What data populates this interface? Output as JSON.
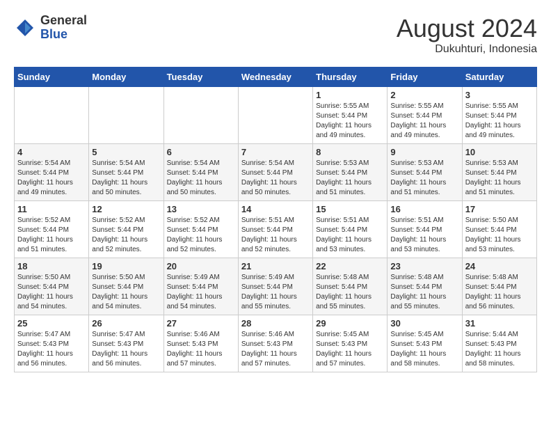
{
  "logo": {
    "general": "General",
    "blue": "Blue"
  },
  "title": {
    "month": "August 2024",
    "location": "Dukuhturi, Indonesia"
  },
  "days_of_week": [
    "Sunday",
    "Monday",
    "Tuesday",
    "Wednesday",
    "Thursday",
    "Friday",
    "Saturday"
  ],
  "weeks": [
    [
      {
        "day": "",
        "sunrise": "",
        "sunset": "",
        "daylight": ""
      },
      {
        "day": "",
        "sunrise": "",
        "sunset": "",
        "daylight": ""
      },
      {
        "day": "",
        "sunrise": "",
        "sunset": "",
        "daylight": ""
      },
      {
        "day": "",
        "sunrise": "",
        "sunset": "",
        "daylight": ""
      },
      {
        "day": "1",
        "sunrise": "Sunrise: 5:55 AM",
        "sunset": "Sunset: 5:44 PM",
        "daylight": "Daylight: 11 hours and 49 minutes."
      },
      {
        "day": "2",
        "sunrise": "Sunrise: 5:55 AM",
        "sunset": "Sunset: 5:44 PM",
        "daylight": "Daylight: 11 hours and 49 minutes."
      },
      {
        "day": "3",
        "sunrise": "Sunrise: 5:55 AM",
        "sunset": "Sunset: 5:44 PM",
        "daylight": "Daylight: 11 hours and 49 minutes."
      }
    ],
    [
      {
        "day": "4",
        "sunrise": "Sunrise: 5:54 AM",
        "sunset": "Sunset: 5:44 PM",
        "daylight": "Daylight: 11 hours and 49 minutes."
      },
      {
        "day": "5",
        "sunrise": "Sunrise: 5:54 AM",
        "sunset": "Sunset: 5:44 PM",
        "daylight": "Daylight: 11 hours and 50 minutes."
      },
      {
        "day": "6",
        "sunrise": "Sunrise: 5:54 AM",
        "sunset": "Sunset: 5:44 PM",
        "daylight": "Daylight: 11 hours and 50 minutes."
      },
      {
        "day": "7",
        "sunrise": "Sunrise: 5:54 AM",
        "sunset": "Sunset: 5:44 PM",
        "daylight": "Daylight: 11 hours and 50 minutes."
      },
      {
        "day": "8",
        "sunrise": "Sunrise: 5:53 AM",
        "sunset": "Sunset: 5:44 PM",
        "daylight": "Daylight: 11 hours and 51 minutes."
      },
      {
        "day": "9",
        "sunrise": "Sunrise: 5:53 AM",
        "sunset": "Sunset: 5:44 PM",
        "daylight": "Daylight: 11 hours and 51 minutes."
      },
      {
        "day": "10",
        "sunrise": "Sunrise: 5:53 AM",
        "sunset": "Sunset: 5:44 PM",
        "daylight": "Daylight: 11 hours and 51 minutes."
      }
    ],
    [
      {
        "day": "11",
        "sunrise": "Sunrise: 5:52 AM",
        "sunset": "Sunset: 5:44 PM",
        "daylight": "Daylight: 11 hours and 51 minutes."
      },
      {
        "day": "12",
        "sunrise": "Sunrise: 5:52 AM",
        "sunset": "Sunset: 5:44 PM",
        "daylight": "Daylight: 11 hours and 52 minutes."
      },
      {
        "day": "13",
        "sunrise": "Sunrise: 5:52 AM",
        "sunset": "Sunset: 5:44 PM",
        "daylight": "Daylight: 11 hours and 52 minutes."
      },
      {
        "day": "14",
        "sunrise": "Sunrise: 5:51 AM",
        "sunset": "Sunset: 5:44 PM",
        "daylight": "Daylight: 11 hours and 52 minutes."
      },
      {
        "day": "15",
        "sunrise": "Sunrise: 5:51 AM",
        "sunset": "Sunset: 5:44 PM",
        "daylight": "Daylight: 11 hours and 53 minutes."
      },
      {
        "day": "16",
        "sunrise": "Sunrise: 5:51 AM",
        "sunset": "Sunset: 5:44 PM",
        "daylight": "Daylight: 11 hours and 53 minutes."
      },
      {
        "day": "17",
        "sunrise": "Sunrise: 5:50 AM",
        "sunset": "Sunset: 5:44 PM",
        "daylight": "Daylight: 11 hours and 53 minutes."
      }
    ],
    [
      {
        "day": "18",
        "sunrise": "Sunrise: 5:50 AM",
        "sunset": "Sunset: 5:44 PM",
        "daylight": "Daylight: 11 hours and 54 minutes."
      },
      {
        "day": "19",
        "sunrise": "Sunrise: 5:50 AM",
        "sunset": "Sunset: 5:44 PM",
        "daylight": "Daylight: 11 hours and 54 minutes."
      },
      {
        "day": "20",
        "sunrise": "Sunrise: 5:49 AM",
        "sunset": "Sunset: 5:44 PM",
        "daylight": "Daylight: 11 hours and 54 minutes."
      },
      {
        "day": "21",
        "sunrise": "Sunrise: 5:49 AM",
        "sunset": "Sunset: 5:44 PM",
        "daylight": "Daylight: 11 hours and 55 minutes."
      },
      {
        "day": "22",
        "sunrise": "Sunrise: 5:48 AM",
        "sunset": "Sunset: 5:44 PM",
        "daylight": "Daylight: 11 hours and 55 minutes."
      },
      {
        "day": "23",
        "sunrise": "Sunrise: 5:48 AM",
        "sunset": "Sunset: 5:44 PM",
        "daylight": "Daylight: 11 hours and 55 minutes."
      },
      {
        "day": "24",
        "sunrise": "Sunrise: 5:48 AM",
        "sunset": "Sunset: 5:44 PM",
        "daylight": "Daylight: 11 hours and 56 minutes."
      }
    ],
    [
      {
        "day": "25",
        "sunrise": "Sunrise: 5:47 AM",
        "sunset": "Sunset: 5:43 PM",
        "daylight": "Daylight: 11 hours and 56 minutes."
      },
      {
        "day": "26",
        "sunrise": "Sunrise: 5:47 AM",
        "sunset": "Sunset: 5:43 PM",
        "daylight": "Daylight: 11 hours and 56 minutes."
      },
      {
        "day": "27",
        "sunrise": "Sunrise: 5:46 AM",
        "sunset": "Sunset: 5:43 PM",
        "daylight": "Daylight: 11 hours and 57 minutes."
      },
      {
        "day": "28",
        "sunrise": "Sunrise: 5:46 AM",
        "sunset": "Sunset: 5:43 PM",
        "daylight": "Daylight: 11 hours and 57 minutes."
      },
      {
        "day": "29",
        "sunrise": "Sunrise: 5:45 AM",
        "sunset": "Sunset: 5:43 PM",
        "daylight": "Daylight: 11 hours and 57 minutes."
      },
      {
        "day": "30",
        "sunrise": "Sunrise: 5:45 AM",
        "sunset": "Sunset: 5:43 PM",
        "daylight": "Daylight: 11 hours and 58 minutes."
      },
      {
        "day": "31",
        "sunrise": "Sunrise: 5:44 AM",
        "sunset": "Sunset: 5:43 PM",
        "daylight": "Daylight: 11 hours and 58 minutes."
      }
    ]
  ]
}
